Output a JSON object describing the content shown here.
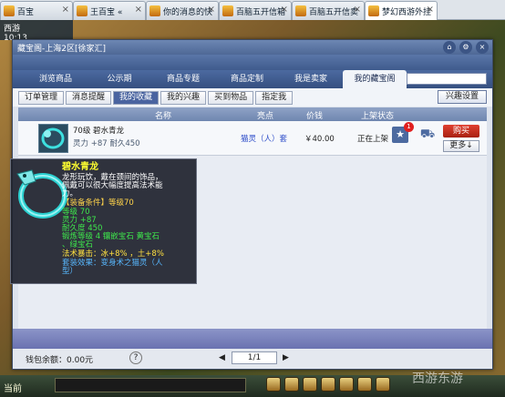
{
  "tabs": [
    {
      "label": "百宝",
      "active": false
    },
    {
      "label": "王百宝 «",
      "active": false
    },
    {
      "label": "你的消息的快",
      "active": false
    },
    {
      "label": "百脑五开信箱",
      "active": false
    },
    {
      "label": "百脑五开信卖",
      "active": false
    },
    {
      "label": "梦幻西游外挂",
      "active": true
    }
  ],
  "hud": {
    "line1": "西游",
    "line2": "10:13"
  },
  "dialog": {
    "title": "藏宝阁-上海2区[徐家汇]",
    "nav": [
      {
        "label": "浏览商品",
        "active": false
      },
      {
        "label": "公示期",
        "active": false
      },
      {
        "label": "商品专题",
        "active": false
      },
      {
        "label": "商品定制",
        "active": false
      },
      {
        "label": "我是卖家",
        "active": false
      },
      {
        "label": "我的藏宝阁",
        "active": true
      }
    ],
    "subtabs": [
      {
        "label": "订单管理",
        "active": false
      },
      {
        "label": "消息提醒",
        "active": false
      },
      {
        "label": "我的收藏",
        "active": true
      },
      {
        "label": "我的兴趣",
        "active": false
      },
      {
        "label": "买到物品",
        "active": false
      },
      {
        "label": "指定我",
        "active": false
      }
    ],
    "interest_button": "兴趣设置",
    "columns": [
      "名称",
      "亮点",
      "价钱",
      "上架状态"
    ],
    "item": {
      "name_line": "70级 碧水青龙",
      "attrs": "灵力 +87 耐久450",
      "highlight": "猫灵（人）套",
      "price": "￥40.00",
      "status": "正在上架",
      "badge": "1",
      "buy_label": "购买",
      "more_label": "更多↓"
    },
    "balance": "钱包余额：0.00元",
    "help": "?",
    "page": "1/1"
  },
  "tooltip": {
    "title": "碧水青龙",
    "desc": [
      "龙形玩饮，戴在颈间的饰品，",
      "佩戴可以很大幅度提高法术能",
      "力。"
    ],
    "req": "【装备条件】等级70",
    "stats": [
      "等级 70",
      "灵力 +87",
      "耐久度 450",
      "锻炼等级 4  镶嵌宝石 黄宝石",
      "、绿宝石"
    ],
    "special": "法术暴击：冰+8%  ，土+8%",
    "set": [
      "套装效果：变身术之猫灵（人",
      "型）"
    ]
  },
  "chat": {
    "label": "当前"
  },
  "watermark": "西游东游",
  "colors": {
    "title": "#ffff30",
    "desc": "#ffffff",
    "req": "#ffd34a",
    "stats": "#3ee84c",
    "special": "#ffe040",
    "set": "#58b8ff",
    "buy": "#c83020",
    "nav": "#354f80"
  }
}
